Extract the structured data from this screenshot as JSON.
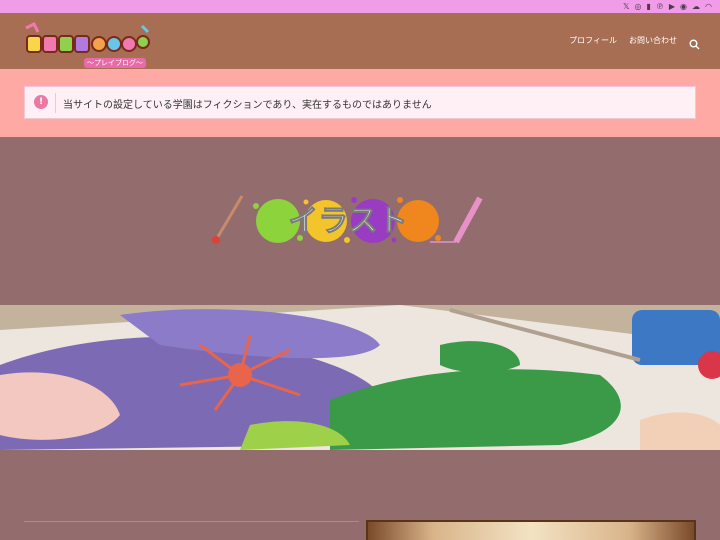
{
  "topbar": {
    "social_icons": [
      "x-icon",
      "instagram-icon",
      "note-icon",
      "pinterest-icon",
      "youtube-icon",
      "threads-icon",
      "cloud-icon",
      "rss-icon"
    ],
    "glyphs": [
      "𝕏",
      "◎",
      "▮",
      "℗",
      "▶",
      "◉",
      "☁",
      "◠"
    ]
  },
  "header": {
    "logo_text": "PrinCloud",
    "logo_sub": "〜プレイブログ〜",
    "nav": [
      {
        "label": "プロフィール"
      },
      {
        "label": "お問い合わせ"
      }
    ]
  },
  "notice": {
    "icon": "info-icon",
    "message": "当サイトの設定している学園はフィクションであり、実在するものではありません"
  },
  "hero": {
    "title": "イラスト"
  },
  "colors": {
    "topbar": "#f09ce8",
    "header": "#a76e53",
    "notice_band": "#fea9a3",
    "body": "#936d6d",
    "accent_pink": "#ea7aa4"
  }
}
